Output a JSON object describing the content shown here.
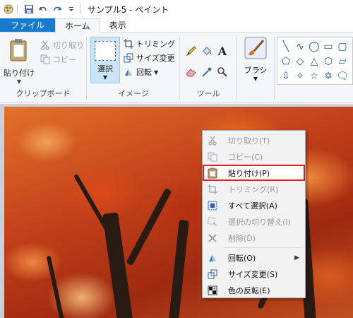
{
  "window": {
    "title": "サンプル5 - ペイント"
  },
  "tabs": [
    {
      "label": "ファイル"
    },
    {
      "label": "ホーム"
    },
    {
      "label": "表示"
    }
  ],
  "ribbon": {
    "clipboard": {
      "paste_label": "貼り付け",
      "cut_label": "切り取り",
      "copy_label": "コピー",
      "group_label": "クリップボード"
    },
    "image": {
      "select_label": "選択",
      "crop_label": "トリミング",
      "resize_label": "サイズ変更",
      "rotate_label": "回転",
      "group_label": "イメージ"
    },
    "tools": {
      "group_label": "ツール"
    },
    "brush": {
      "label": "ブラシ"
    }
  },
  "context_menu": {
    "items": [
      {
        "label": "切り取り(T)",
        "enabled": false,
        "icon": "cut-icon"
      },
      {
        "label": "コピー(C)",
        "enabled": false,
        "icon": "copy-icon"
      },
      {
        "label": "貼り付け(P)",
        "enabled": true,
        "icon": "paste-icon",
        "highlighted": true
      },
      {
        "label": "トリミング(R)",
        "enabled": false,
        "icon": "crop-icon"
      },
      {
        "label": "すべて選択(A)",
        "enabled": true,
        "icon": "select-all-icon"
      },
      {
        "label": "選択の切り替え(I)",
        "enabled": false,
        "icon": "invert-selection-icon"
      },
      {
        "label": "削除(D)",
        "enabled": false,
        "icon": "delete-icon"
      },
      {
        "label": "回転(O)",
        "enabled": true,
        "icon": "rotate-icon",
        "submenu": true
      },
      {
        "label": "サイズ変更(S)",
        "enabled": true,
        "icon": "resize-icon"
      },
      {
        "label": "色の反転(E)",
        "enabled": true,
        "icon": "invert-color-icon"
      }
    ]
  },
  "colors": {
    "file_tab": "#1979ca",
    "highlight_outline": "#e02020",
    "select_button": "#cce4f7"
  }
}
